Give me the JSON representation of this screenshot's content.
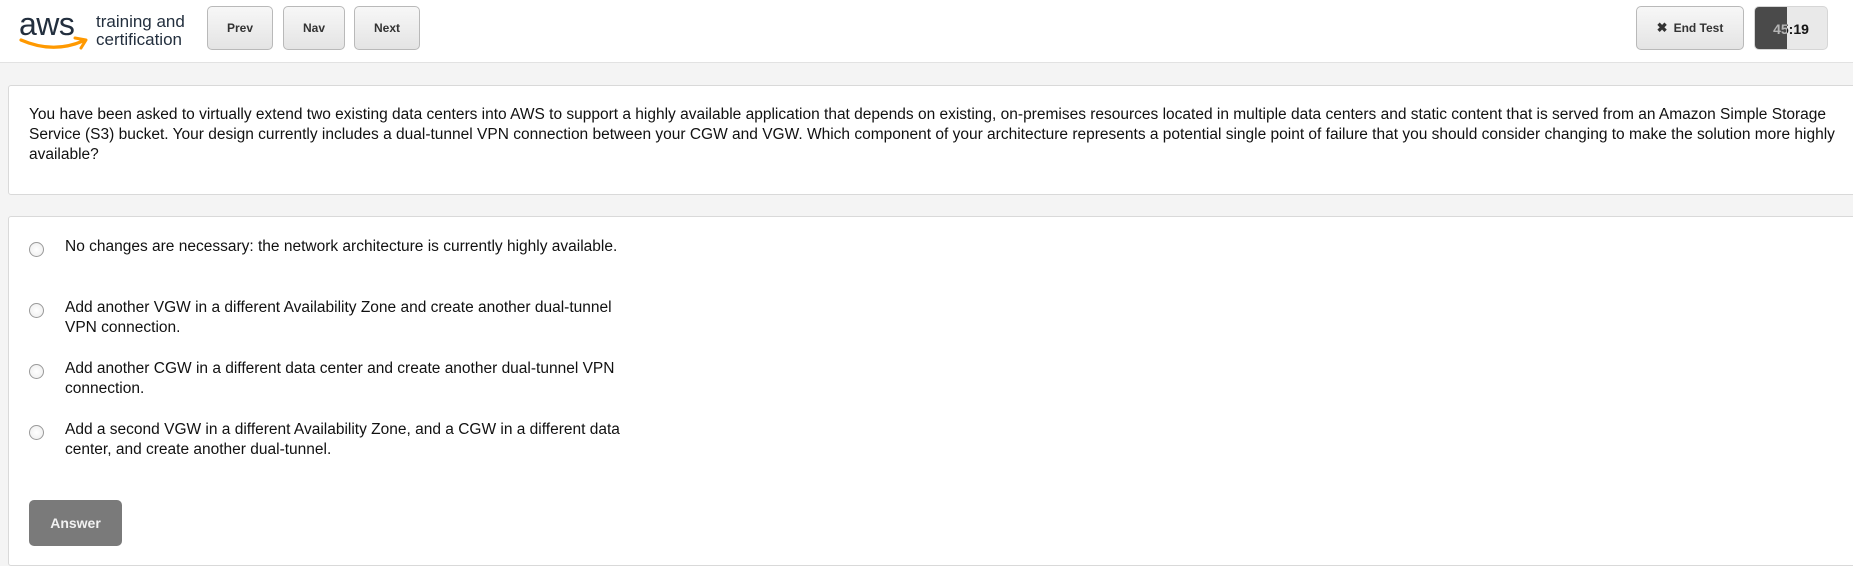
{
  "brand": {
    "logo_text": "aws",
    "tagline_line1": "training and",
    "tagline_line2": "certification",
    "accent_color": "#ff9900"
  },
  "toolbar": {
    "prev_label": "Prev",
    "nav_label": "Nav",
    "next_label": "Next",
    "end_test_label": "End Test",
    "end_test_icon": "close-icon",
    "timer_value": "45:19"
  },
  "question": {
    "text": "You have been asked to virtually extend two existing data centers into AWS to support a highly available application that depends on existing, on-premises resources located in multiple data centers and static content that is served from an Amazon Simple Storage Service (S3) bucket. Your design currently includes a dual-tunnel VPN connection between your CGW and VGW. Which component of your architecture represents a potential single point of failure that you should consider changing to make the solution more highly available?"
  },
  "options": [
    {
      "label": "No changes are necessary: the network architecture is currently highly available.",
      "selected": false
    },
    {
      "label": "Add another VGW in a different Availability Zone and create another dual-tunnel VPN connection.",
      "selected": false
    },
    {
      "label": "Add another CGW in a different data center and create another dual-tunnel VPN connection.",
      "selected": false
    },
    {
      "label": "Add a second VGW in a different Availability Zone, and a CGW in a different data center, and create another dual-tunnel.",
      "selected": false
    }
  ],
  "answer_button_label": "Answer"
}
